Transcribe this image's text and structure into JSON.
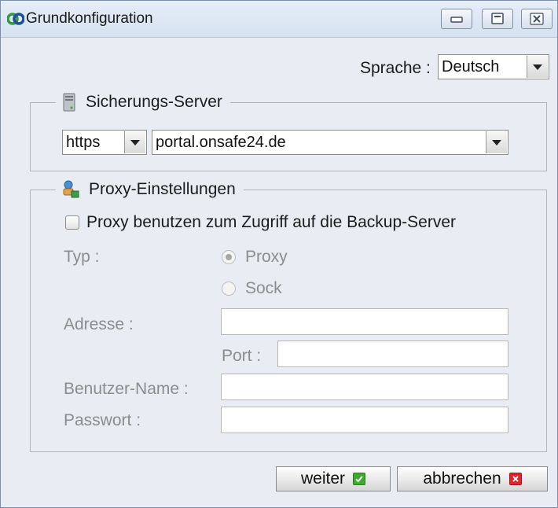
{
  "window": {
    "title": "Grundkonfiguration",
    "icons": {
      "app": "onsafe-logo-icon",
      "minimize": "minimize-icon",
      "maximize": "maximize-icon",
      "close": "close-icon"
    }
  },
  "language": {
    "label": "Sprache :",
    "value": "Deutsch"
  },
  "backup_server": {
    "legend": "Sicherungs-Server",
    "icon": "server-icon",
    "protocol": "https",
    "host": "portal.onsafe24.de"
  },
  "proxy": {
    "legend": "Proxy-Einstellungen",
    "icon": "proxy-network-icon",
    "use_proxy_label": "Proxy benutzen zum Zugriff auf die Backup-Server",
    "use_proxy_checked": false,
    "type_label": "Typ :",
    "type_options": [
      "Proxy",
      "Sock"
    ],
    "type_selected": "Proxy",
    "address_label": "Adresse :",
    "address_value": "",
    "port_label": "Port :",
    "port_value": "",
    "username_label": "Benutzer-Name :",
    "username_value": "",
    "password_label": "Passwort :",
    "password_value": ""
  },
  "buttons": {
    "next": "weiter",
    "cancel": "abbrechen",
    "colors": {
      "ok": "#3fa92d",
      "cancel": "#e0252a"
    }
  }
}
